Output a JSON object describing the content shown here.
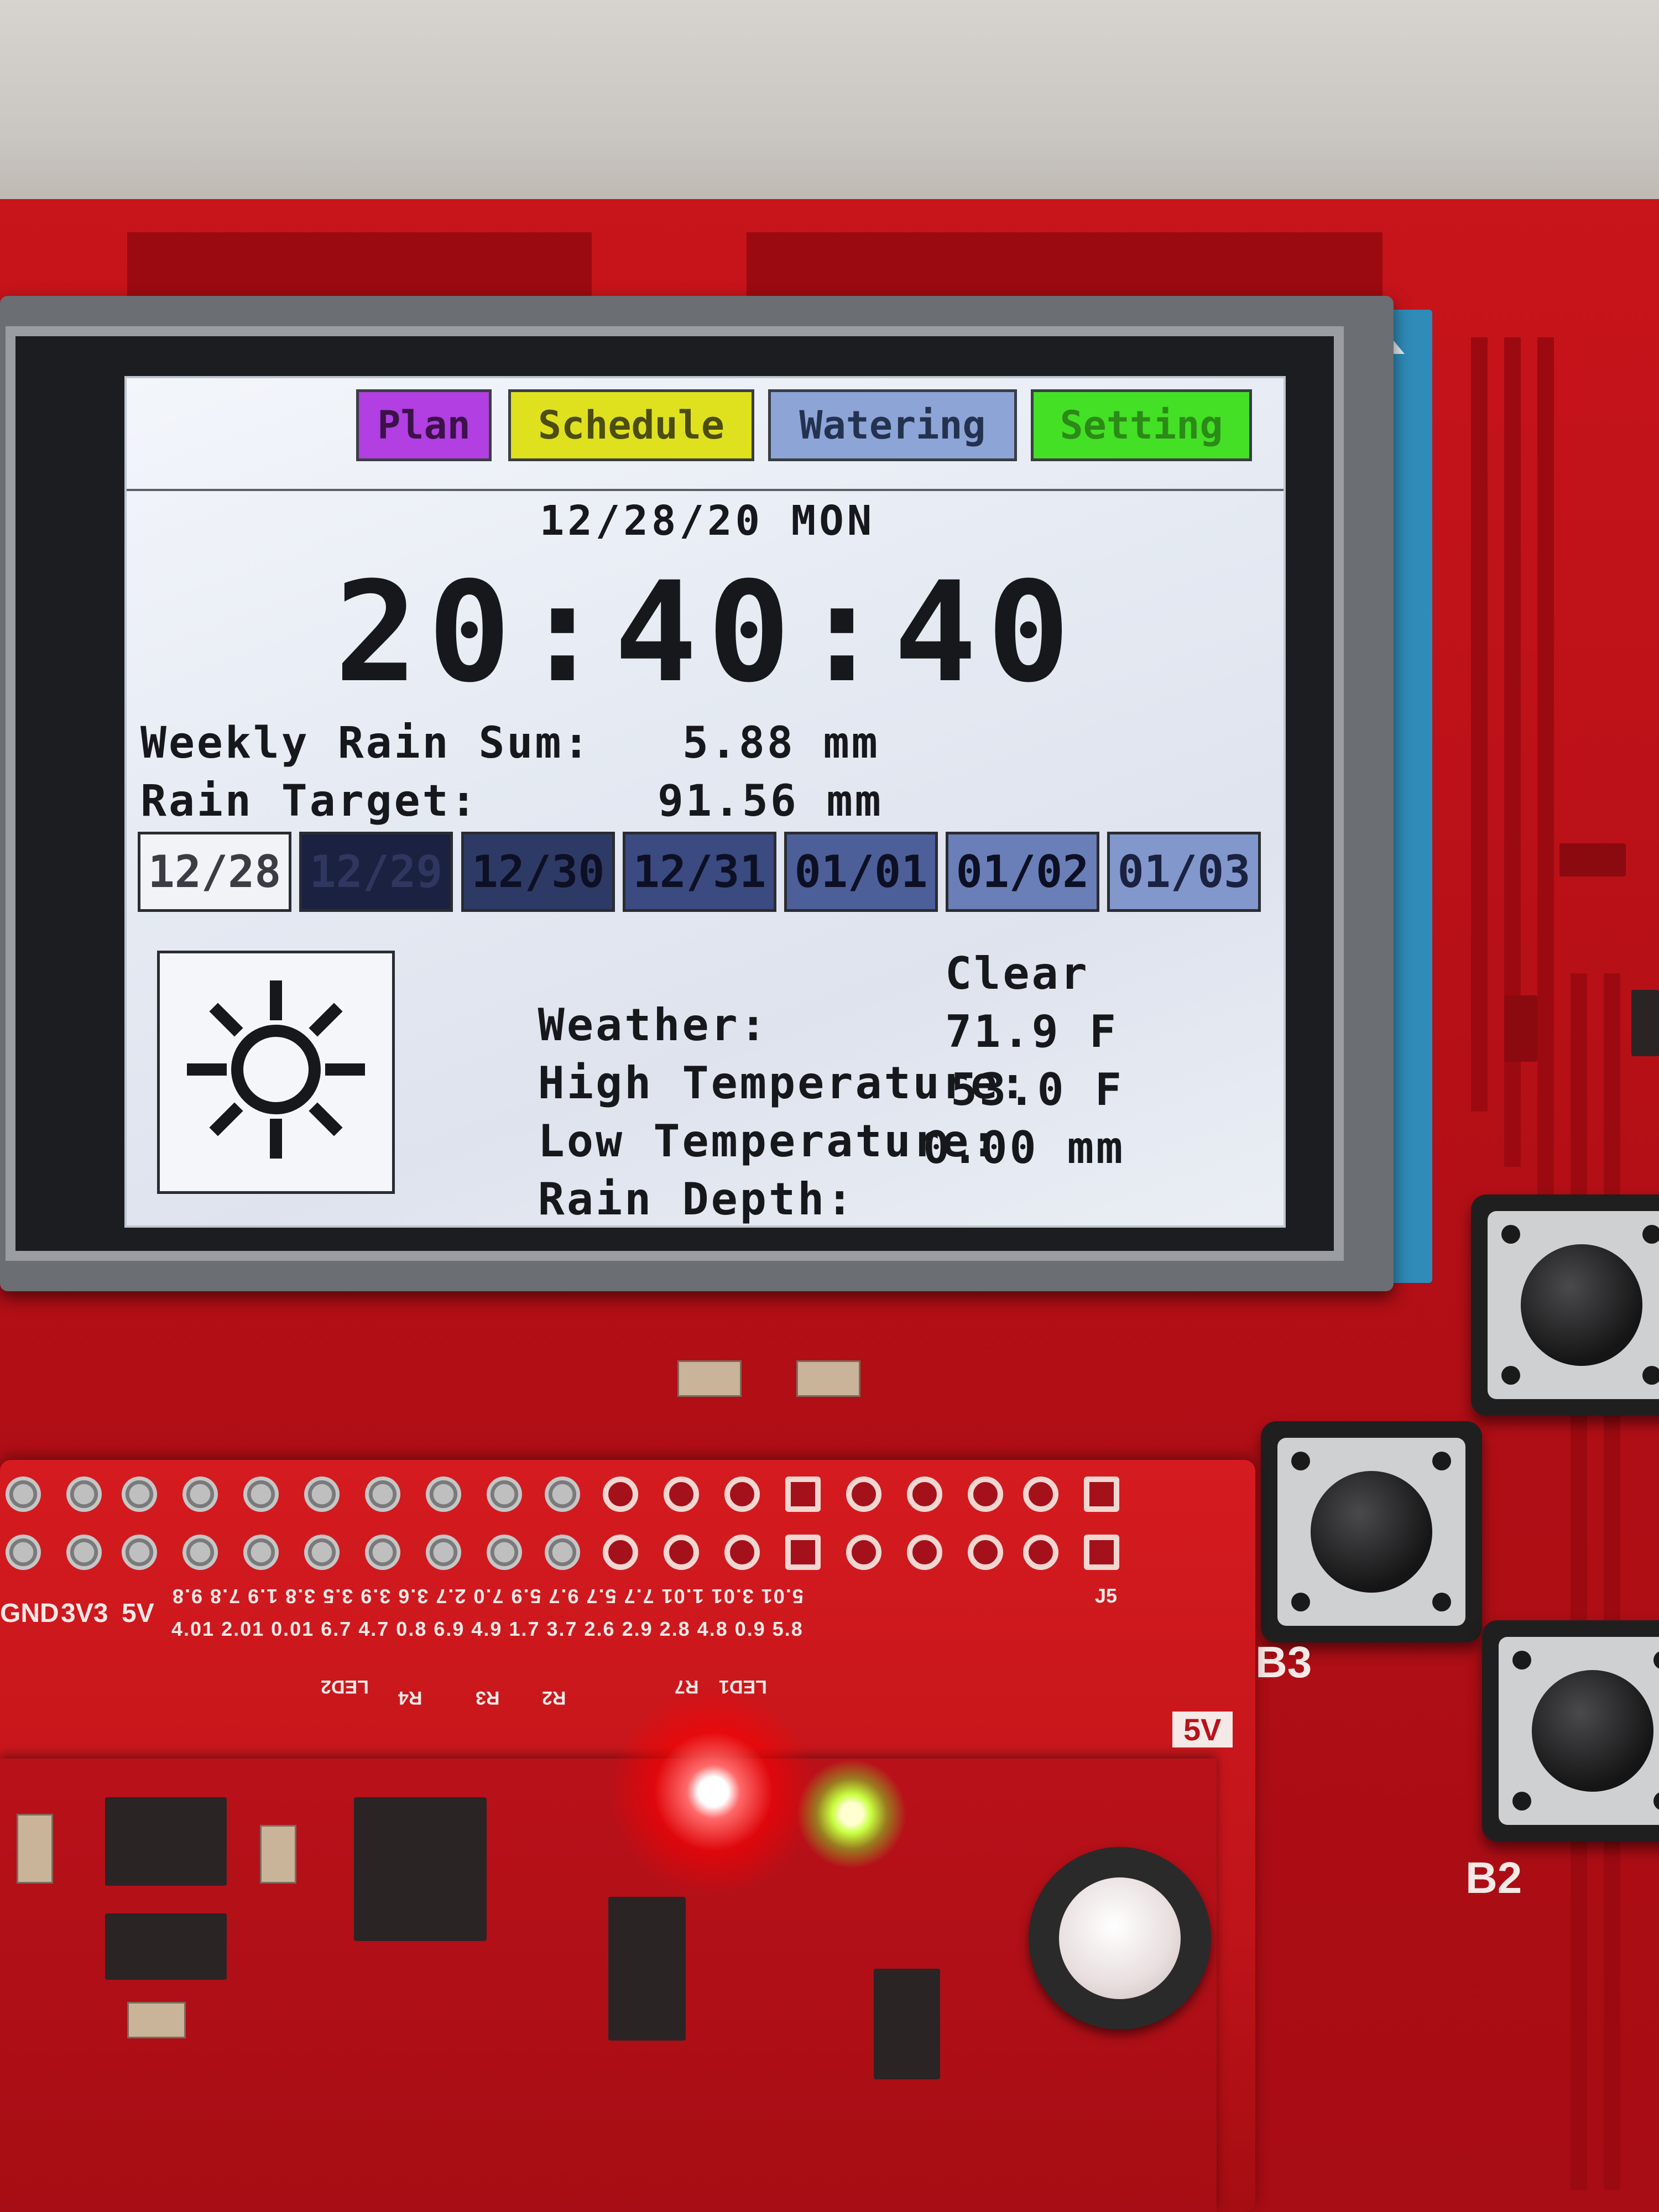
{
  "tabs": {
    "plan": "Plan",
    "schedule": "Schedule",
    "watering": "Watering",
    "setting": "Setting"
  },
  "status": {
    "date": "12/28/20 MON",
    "time": "20:40:40"
  },
  "rain": {
    "weekly_label": "Weekly Rain Sum:",
    "weekly_value": "5.88 mm",
    "target_label": "Rain Target:",
    "target_value": "91.56 mm"
  },
  "days": [
    "12/28",
    "12/29",
    "12/30",
    "12/31",
    "01/01",
    "01/02",
    "01/03"
  ],
  "weather": {
    "icon": "sun-icon",
    "condition_label": "Weather:",
    "condition_value": "Clear",
    "high_label": "High Temperature:",
    "high_value": "71.9 F",
    "low_label": "Low Temperature:",
    "low_value": "53.0 F",
    "rain_label": "Rain Depth:",
    "rain_value": "0.00 mm"
  },
  "board": {
    "button_labels": {
      "b3": "B3",
      "b2": "B2"
    },
    "pin_labels": {
      "gnd": "GND",
      "v33": "3V3",
      "v5": "5V",
      "v5_right": "5V"
    },
    "led_labels": {
      "led1": "LED1",
      "led2": "LED2",
      "r7": "R7",
      "r4": "R4",
      "r3": "R3",
      "r2": "R2"
    },
    "j5_label": "J5",
    "pin_row_top": "5.01 3.01 1.01 7.7 5.7 9.7 5.9 7.0 2.7 3.6 3.9 3.5 3.8 1.9 7.8 9.8",
    "pin_row_bottom": "4.01 2.01 0.01 6.7 4.7 0.8 6.9 4.9 1.7 3.7 2.6 2.9 2.8 4.8 0.9 5.8"
  },
  "colors": {
    "plan": "#b13fe1",
    "schedule": "#dfe11e",
    "watering": "#8da4d6",
    "setting": "#44e025",
    "pcb": "#c8141b",
    "led_red": "#ff2020",
    "led_green": "#9cff30"
  }
}
